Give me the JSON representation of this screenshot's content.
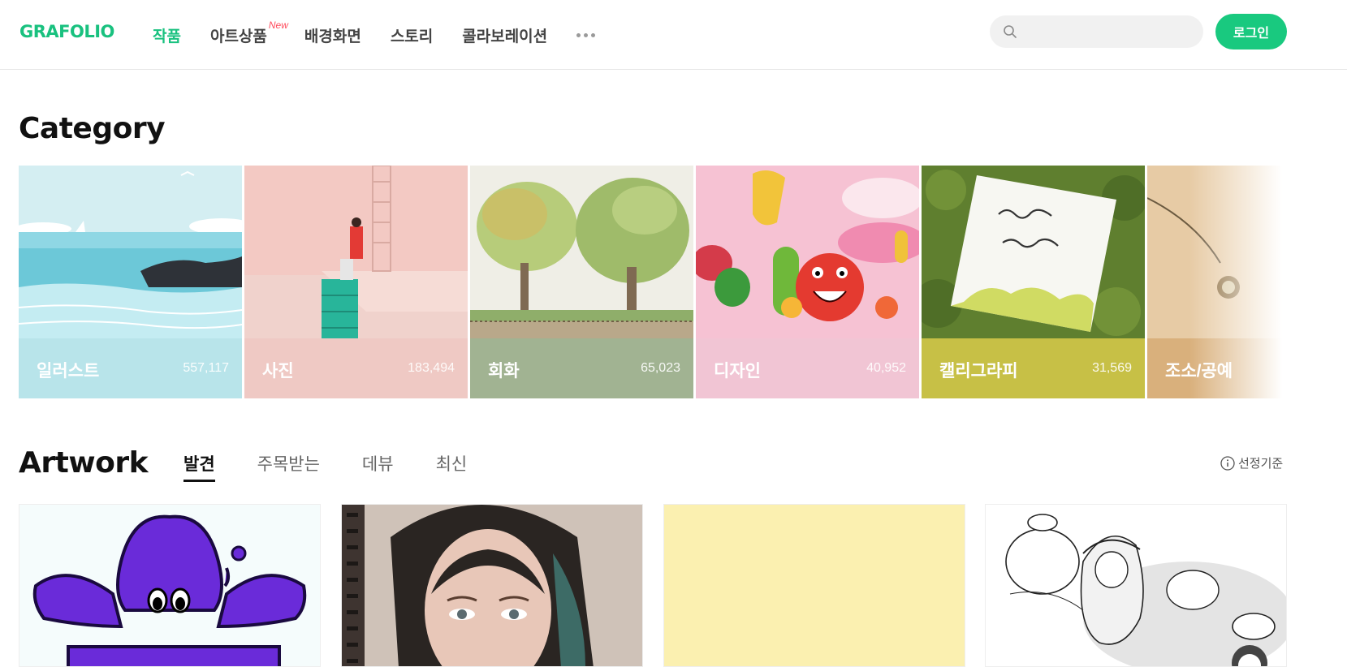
{
  "header": {
    "logo": "GRAFOLIO",
    "nav": [
      {
        "label": "작품",
        "active": true
      },
      {
        "label": "아트상품",
        "badge": "New"
      },
      {
        "label": "배경화면"
      },
      {
        "label": "스토리"
      },
      {
        "label": "콜라보레이션"
      }
    ],
    "more_icon": "more-dots-icon",
    "search": {
      "placeholder": "",
      "value": "",
      "icon": "search-icon"
    },
    "login_label": "로그인"
  },
  "category": {
    "title": "Category",
    "items": [
      {
        "name": "일러스트",
        "count": "557,117",
        "color": "#b8e4ea"
      },
      {
        "name": "사진",
        "count": "183,494",
        "color": "#efc9c4"
      },
      {
        "name": "회화",
        "count": "65,023",
        "color": "#a1b392"
      },
      {
        "name": "디자인",
        "count": "40,952",
        "color": "#f1c5d4"
      },
      {
        "name": "캘리그라피",
        "count": "31,569",
        "color": "#c7c046"
      },
      {
        "name": "조소/공예",
        "count": "",
        "color": "#d9b07c"
      }
    ]
  },
  "artwork": {
    "title": "Artwork",
    "tabs": [
      {
        "label": "발견",
        "active": true
      },
      {
        "label": "주목받는"
      },
      {
        "label": "데뷰"
      },
      {
        "label": "최신"
      }
    ],
    "criteria_label": "선정기준",
    "cards": [
      {
        "label": "art-1"
      },
      {
        "label": "art-2"
      },
      {
        "label": "art-3"
      },
      {
        "label": "art-4"
      }
    ]
  },
  "colors": {
    "brand": "#19c17f",
    "new_badge": "#ff4b5c"
  }
}
